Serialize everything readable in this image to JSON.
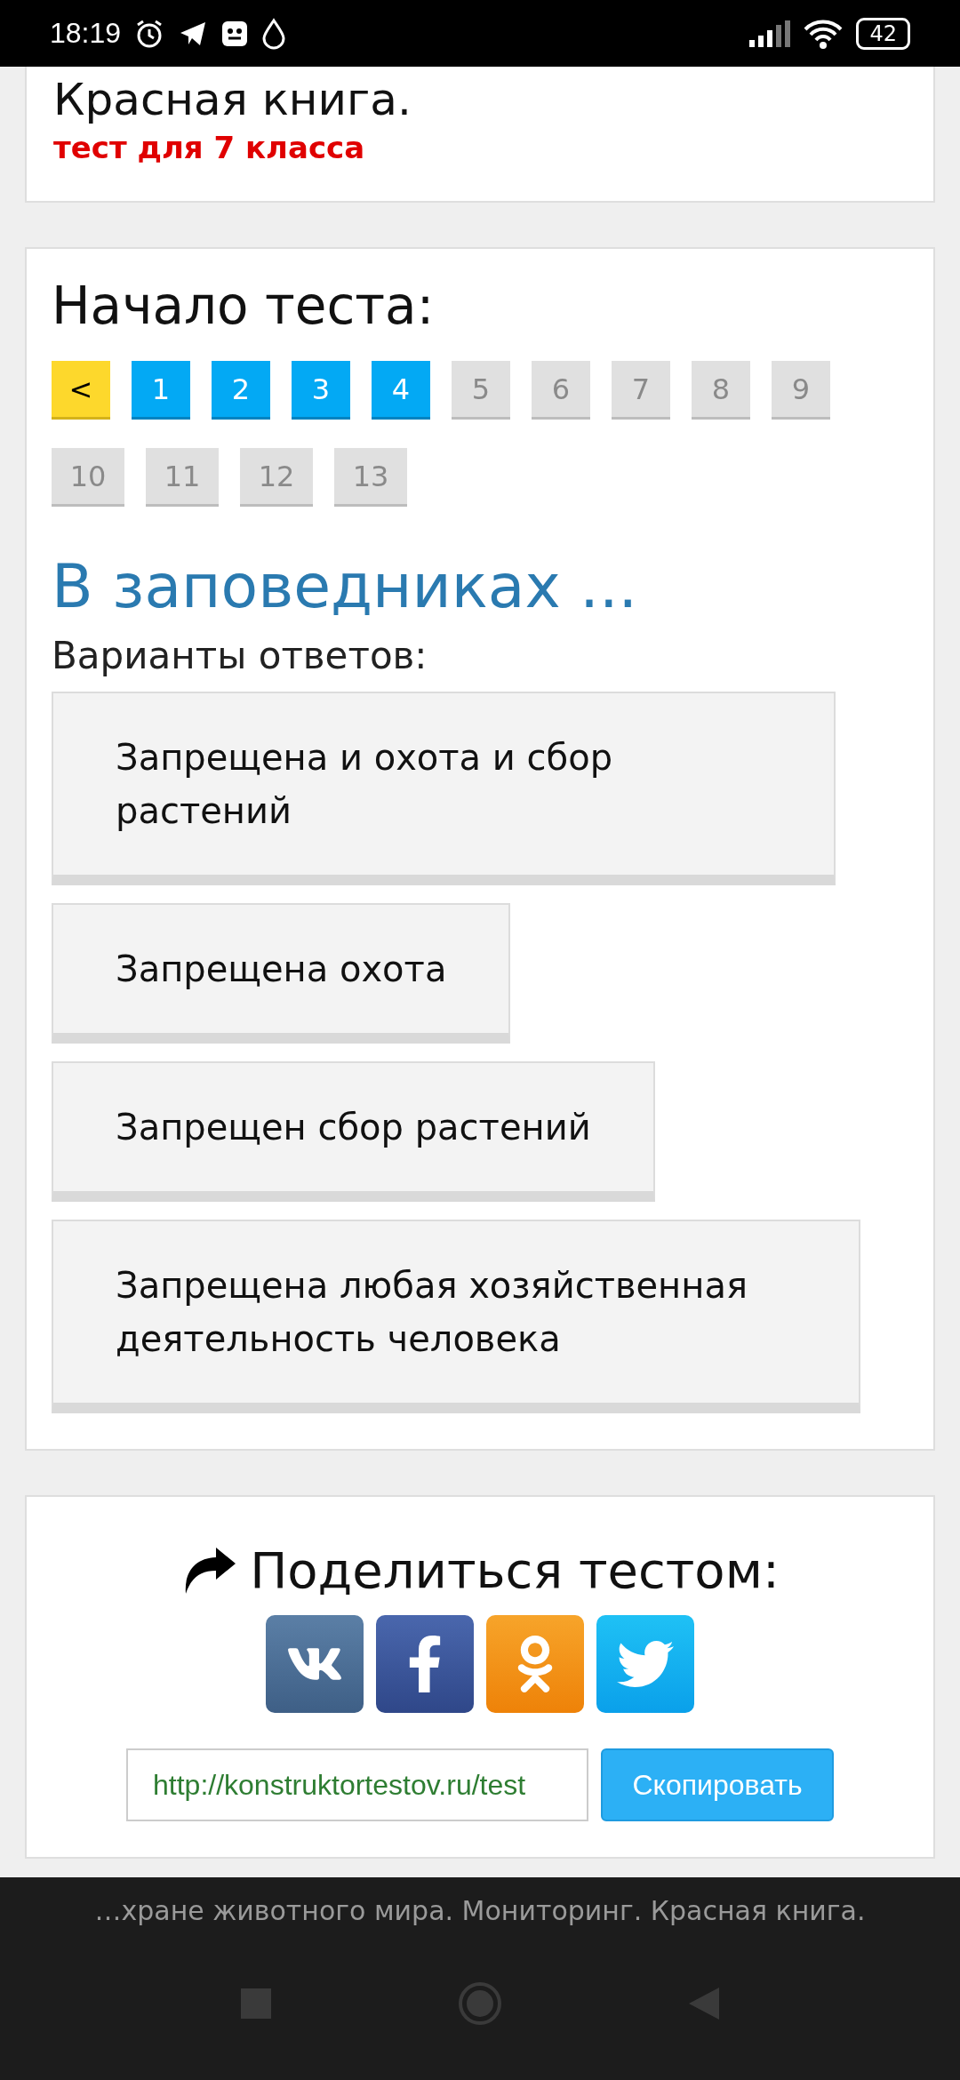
{
  "status_bar": {
    "time": "18:19",
    "battery": "42"
  },
  "header_card": {
    "title": "Красная книга.",
    "subtitle": "тест для 7 класса"
  },
  "test": {
    "heading": "Начало теста:",
    "pagination": [
      {
        "kind": "back",
        "label": "<"
      },
      {
        "kind": "page",
        "label": "1",
        "answered": true
      },
      {
        "kind": "page",
        "label": "2",
        "answered": true
      },
      {
        "kind": "page",
        "label": "3",
        "answered": true
      },
      {
        "kind": "page",
        "label": "4",
        "answered": true
      },
      {
        "kind": "page",
        "label": "5",
        "answered": false
      },
      {
        "kind": "page",
        "label": "6",
        "answered": false
      },
      {
        "kind": "page",
        "label": "7",
        "answered": false
      },
      {
        "kind": "page",
        "label": "8",
        "answered": false
      },
      {
        "kind": "page",
        "label": "9",
        "answered": false
      },
      {
        "kind": "page",
        "label": "10",
        "answered": false
      },
      {
        "kind": "page",
        "label": "11",
        "answered": false
      },
      {
        "kind": "page",
        "label": "12",
        "answered": false
      },
      {
        "kind": "page",
        "label": "13",
        "answered": false
      }
    ],
    "question": "В заповедниках ...",
    "answers_label": "Варианты ответов:",
    "answers": [
      "Запрещена и охота и сбор растений",
      "Запрещена охота",
      "Запрещен сбор растений",
      "Запрещена любая хозяйственная деятельность человека"
    ]
  },
  "share": {
    "title": "Поделиться тестом:",
    "networks": [
      {
        "kind": "vk"
      },
      {
        "kind": "facebook"
      },
      {
        "kind": "odnoklassniki"
      },
      {
        "kind": "twitter"
      }
    ],
    "link": {
      "value": "http://konstruktortestov.ru/test",
      "button": "Скопировать"
    }
  },
  "browser_bar": {
    "title": "…хране животного мира. Мониторинг. Красная книга."
  }
}
